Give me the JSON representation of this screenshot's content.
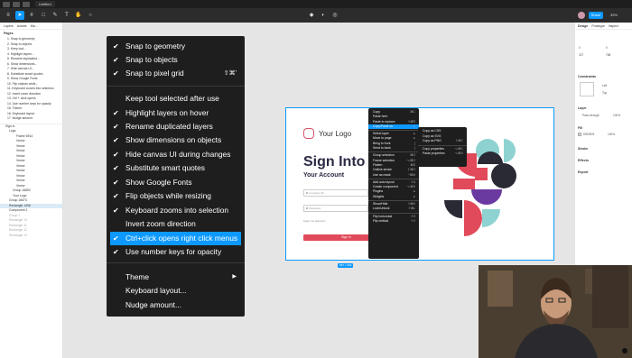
{
  "window": {
    "tab_title": "Untitled"
  },
  "toolbar": {
    "share_label": "Share",
    "zoom": "39%"
  },
  "left_panel": {
    "tabs": [
      "Layers",
      "Assets",
      "Ma..."
    ],
    "pages_heading": "Pages",
    "pages": [
      "1. Snap to geometry",
      "2. Snap to objects",
      "3. Keep tool...",
      "4. Highlight layers...",
      "5. Rename duplicated...",
      "6. Show dimensions...",
      "7. Hide canvas UI...",
      "8. Substitute smart quotes",
      "9. Show Google Fonts",
      "10. Flip objects while...",
      "11. Keyboard zooms into selection",
      "12. Invert zoom direction",
      "13. Ctrl + click opens",
      "14. Use number keys for opacity",
      "15. Theme",
      "16. Keyboard layout",
      "17. Nudge amount"
    ],
    "layers": [
      "Sign in",
      "Logo",
      "Frame 6914",
      "Vector",
      "Vector",
      "Vector",
      "Vector",
      "Vector",
      "Vector",
      "Vector",
      "Vector",
      "Vector",
      "Vector",
      "Group 16852",
      "Your Logo",
      "Group 16874",
      "Rectangle 1498",
      "Component 1",
      "Group 1",
      "Rectangle 10",
      "Rectangle 11",
      "Rectangle 12",
      "Rectangle 13"
    ]
  },
  "preferences_menu": {
    "items": [
      {
        "label": "Snap to geometry",
        "checked": true
      },
      {
        "label": "Snap to objects",
        "checked": true
      },
      {
        "label": "Snap to pixel grid",
        "checked": true,
        "shortcut": "⇧⌘'"
      },
      {
        "label": "Keep tool selected after use",
        "checked": false
      },
      {
        "label": "Highlight layers on hover",
        "checked": true
      },
      {
        "label": "Rename duplicated layers",
        "checked": true
      },
      {
        "label": "Show dimensions on objects",
        "checked": true
      },
      {
        "label": "Hide canvas UI during changes",
        "checked": true
      },
      {
        "label": "Substitute smart quotes",
        "checked": true
      },
      {
        "label": "Show Google Fonts",
        "checked": true
      },
      {
        "label": "Flip objects while resizing",
        "checked": true
      },
      {
        "label": "Keyboard zooms into selection",
        "checked": true
      },
      {
        "label": "Invert zoom direction",
        "checked": false
      },
      {
        "label": "Ctrl+click opens right click menus",
        "checked": true,
        "highlighted": true
      },
      {
        "label": "Use number keys for opacity",
        "checked": true
      },
      {
        "label": "Theme",
        "checked": false,
        "submenu": true
      },
      {
        "label": "Keyboard layout...",
        "checked": false
      },
      {
        "label": "Nudge amount...",
        "checked": false
      }
    ]
  },
  "design": {
    "logo_text": "Your Logo",
    "heading": "Sign Into",
    "subheading": "Your Account",
    "field1": "Company ID",
    "field2": "Password",
    "keep_label": "Keep me signed in",
    "submit_label": "Sign in",
    "size_badge": "587 × 382"
  },
  "context_menu": {
    "items": [
      {
        "label": "Copy",
        "shortcut": "⌘C"
      },
      {
        "label": "Paste here",
        "shortcut": ""
      },
      {
        "label": "Paste to replace",
        "shortcut": "⇧⌘R"
      },
      {
        "label": "Copy/Paste as",
        "shortcut": "▸",
        "highlighted": true
      },
      {
        "sep": true
      },
      {
        "label": "Select layer",
        "shortcut": "▸"
      },
      {
        "label": "Move to page",
        "shortcut": "▸"
      },
      {
        "label": "Bring to front",
        "shortcut": "]"
      },
      {
        "label": "Send to back",
        "shortcut": "["
      },
      {
        "sep": true
      },
      {
        "label": "Group selection",
        "shortcut": "⌘G"
      },
      {
        "label": "Frame selection",
        "shortcut": "⌥⌘G"
      },
      {
        "label": "Flatten",
        "shortcut": "⌘E"
      },
      {
        "label": "Outline stroke",
        "shortcut": "⇧⌘O"
      },
      {
        "label": "Use as mask",
        "shortcut": "^⌘M"
      },
      {
        "sep": true
      },
      {
        "label": "Add auto layout",
        "shortcut": "⇧A"
      },
      {
        "label": "Create component",
        "shortcut": "⌥⌘K"
      },
      {
        "label": "Plugins",
        "shortcut": "▸"
      },
      {
        "label": "Widgets",
        "shortcut": "▸"
      },
      {
        "sep": true
      },
      {
        "label": "Show/Hide",
        "shortcut": "⇧⌘H"
      },
      {
        "label": "Lock/Unlock",
        "shortcut": "⇧⌘L"
      },
      {
        "sep": true
      },
      {
        "label": "Flip horizontal",
        "shortcut": "⇧H"
      },
      {
        "label": "Flip vertical",
        "shortcut": "⇧V"
      }
    ]
  },
  "copy_paste_submenu": {
    "items": [
      {
        "label": "Copy as CSS",
        "shortcut": ""
      },
      {
        "label": "Copy as SVG",
        "shortcut": ""
      },
      {
        "label": "Copy as PNG",
        "shortcut": "⇧⌘C"
      },
      {
        "sep": true
      },
      {
        "label": "Copy properties",
        "shortcut": "⌥⌘C"
      },
      {
        "label": "Paste properties",
        "shortcut": "⌥⌘V"
      }
    ]
  },
  "right_panel": {
    "tabs": [
      "Design",
      "Prototype",
      "Inspect"
    ],
    "constraints_heading": "Constraints",
    "constraint_h": "Left",
    "constraint_v": "Top",
    "layer_heading": "Layer",
    "layer_mode": "Pass through",
    "layer_opacity": "100%",
    "fill_heading": "Fill",
    "fill_hex": "D9D9D9",
    "fill_opacity": "100%",
    "stroke_heading": "Stroke",
    "effects_heading": "Effects",
    "export_heading": "Export",
    "x": "0",
    "y": "0",
    "w": "327",
    "h": "788"
  },
  "colors": {
    "accent": "#0d99ff",
    "menu_bg": "#1e1e1e",
    "brand_red": "#e04a5a",
    "teal": "#8ed3d1",
    "purple": "#6b3aa0",
    "dark": "#2a2a35"
  }
}
